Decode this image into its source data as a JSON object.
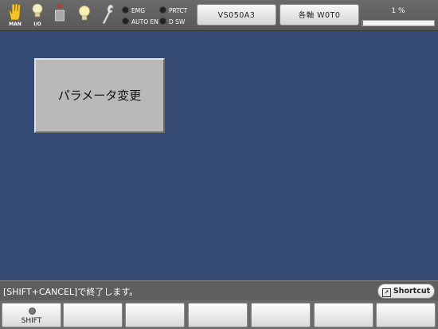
{
  "status_icons": {
    "man_label": "MAN",
    "io_label": "I/O"
  },
  "lamps": {
    "emg": "EMG",
    "prtct": "PRTCT",
    "auto_en": "AUTO EN",
    "d_sw": "D SW"
  },
  "header": {
    "program_button": "VS050A3",
    "axis_button": "各軸 W0T0",
    "speed_text": "1 %",
    "speed_fraction": 0.01
  },
  "main": {
    "param_change_button": "パラメータ変更"
  },
  "message_bar": {
    "message": "[SHIFT+CANCEL]で終了します。",
    "shortcut_label": "Shortcut"
  },
  "function_keys": {
    "shift_label": "SHIFT",
    "f2_label": "",
    "f3_label": "",
    "f4_label": "",
    "f5_label": "",
    "f6_label": "",
    "f7_label": ""
  },
  "colors": {
    "background": "#354b73",
    "toolbar": "#606060",
    "progress_fill": "#3a6bc8"
  }
}
